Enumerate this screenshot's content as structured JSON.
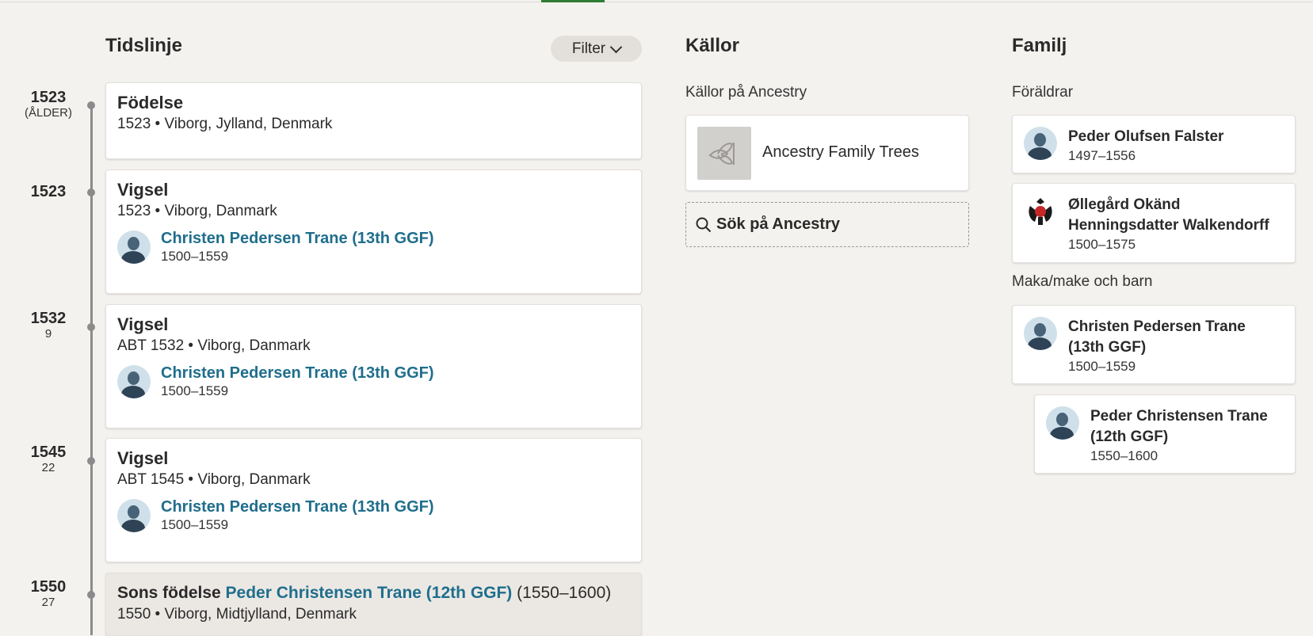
{
  "timeline": {
    "heading": "Tidslinje",
    "filter_label": "Filter",
    "events": [
      {
        "year": "1523",
        "age": "(ÅLDER)",
        "title": "Födelse",
        "place": "1523 • Viborg, Jylland, Denmark"
      },
      {
        "year": "1523",
        "age": "",
        "title": "Vigsel",
        "place": "1523 • Viborg, Danmark",
        "person": {
          "name": "Christen Pedersen Trane (13th GGF)",
          "years": "1500–1559"
        }
      },
      {
        "year": "1532",
        "age": "9",
        "title": "Vigsel",
        "place": "ABT 1532 • Viborg, Danmark",
        "person": {
          "name": "Christen Pedersen Trane (13th GGF)",
          "years": "1500–1559"
        }
      },
      {
        "year": "1545",
        "age": "22",
        "title": "Vigsel",
        "place": "ABT 1545 • Viborg, Danmark",
        "person": {
          "name": "Christen Pedersen Trane (13th GGF)",
          "years": "1500–1559"
        }
      },
      {
        "year": "1550",
        "age": "27",
        "title_prefix": "Sons födelse",
        "title_link": "Peder Christensen Trane (12th GGF)",
        "title_suffix": "(1550–1600)",
        "place": "1550 • Viborg, Midtjylland, Denmark"
      }
    ]
  },
  "sources": {
    "heading": "Källor",
    "subheading": "Källor på Ancestry",
    "items": [
      {
        "label": "Ancestry Family Trees",
        "icon": "ancestry-leaf-icon"
      }
    ],
    "search_label": "Sök på Ancestry"
  },
  "family": {
    "heading": "Familj",
    "parents_heading": "Föräldrar",
    "parents": [
      {
        "name": "Peder Olufsen Falster",
        "years": "1497–1556",
        "icon": "person-avatar-icon"
      },
      {
        "name": "Øllegård Okänd Henningsdatter Walkendorff",
        "years": "1500–1575",
        "icon": "family-crest-icon"
      }
    ],
    "spouse_heading": "Maka/make och barn",
    "spouse": {
      "name": "Christen Pedersen Trane (13th GGF)",
      "years": "1500–1559"
    },
    "children": [
      {
        "name": "Peder Christensen Trane (12th GGF)",
        "years": "1550–1600"
      }
    ]
  },
  "colors": {
    "accent_green": "#2e7d32",
    "link_blue": "#1f6e8c",
    "background": "#f4f2ef"
  }
}
